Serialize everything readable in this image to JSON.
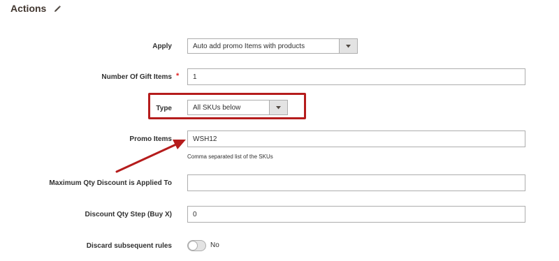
{
  "section": {
    "title": "Actions",
    "edit_icon": "pencil-icon"
  },
  "fields": {
    "apply": {
      "label": "Apply",
      "value": "Auto add promo Items with products"
    },
    "gift_items": {
      "label": "Number Of Gift Items",
      "required_mark": "*",
      "value": "1"
    },
    "type": {
      "label": "Type",
      "value": "All SKUs below"
    },
    "promo_items": {
      "label": "Promo Items",
      "value": "WSH12",
      "note": "Comma separated list of the SKUs"
    },
    "max_qty": {
      "label": "Maximum Qty Discount is Applied To",
      "value": ""
    },
    "discount_step": {
      "label": "Discount Qty Step (Buy X)",
      "value": "0"
    },
    "discard_rules": {
      "label": "Discard subsequent rules",
      "toggle_state": "No"
    }
  },
  "annotation": {
    "highlight_color": "#b51c1c",
    "arrow_color": "#b51c1c"
  }
}
